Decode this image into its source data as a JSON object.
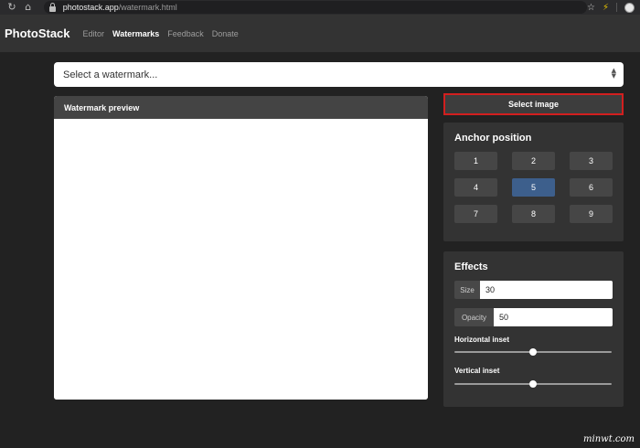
{
  "browser": {
    "url_host": "photostack.app",
    "url_path": "/watermark.html"
  },
  "app": {
    "brand": "PhotoStack",
    "nav": [
      {
        "label": "Editor",
        "active": false
      },
      {
        "label": "Watermarks",
        "active": true
      },
      {
        "label": "Feedback",
        "active": false
      },
      {
        "label": "Donate",
        "active": false
      }
    ]
  },
  "watermark_select": {
    "value": "Select a watermark..."
  },
  "preview": {
    "title": "Watermark preview"
  },
  "select_image_label": "Select image",
  "anchor": {
    "title": "Anchor position",
    "positions": [
      "1",
      "2",
      "3",
      "4",
      "5",
      "6",
      "7",
      "8",
      "9"
    ],
    "selected": "5"
  },
  "effects": {
    "title": "Effects",
    "size_label": "Size",
    "size_value": "30",
    "opacity_label": "Opacity",
    "opacity_value": "50",
    "horizontal_inset_label": "Horizontal inset",
    "horizontal_inset_value": 0.5,
    "vertical_inset_label": "Vertical inset",
    "vertical_inset_value": 0.5
  },
  "site_watermark": "minwt.com",
  "colors": {
    "selected_anchor": "#3d5f8c",
    "highlight_border": "#d21f1f"
  }
}
